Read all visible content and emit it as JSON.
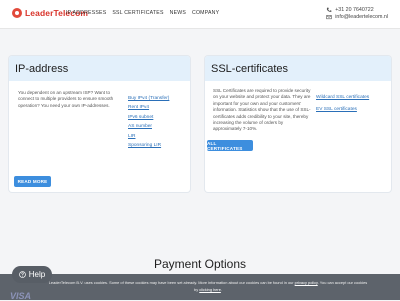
{
  "header": {
    "logo_text": "LeaderTelecom",
    "nav": [
      "IP ADDRESSES",
      "SSL CERTIFICATES",
      "NEWS",
      "COMPANY"
    ],
    "phone": "+31 20 7640722",
    "email": "info@leadertelecom.nl"
  },
  "ip_card": {
    "title": "IP-address",
    "description": "You dependent on an upstream ISP? Want to connect to multiple providers to ensure smooth operation? You need your own IP-addresses.",
    "links": [
      "Buy IPv4 (Transfer)",
      "Rent IPv4",
      "IPv6 subnet",
      "AS number",
      "LIR",
      "Sponsoring LIR"
    ],
    "button": "READ MORE"
  },
  "ssl_card": {
    "title": "SSL-certificates",
    "description": "SSL Certificates are required to provide security on your website and protect your data. They are important for your own and your customers' information. Statistics show that the use of SSL-certificates adds credibility to your site, thereby increasing the volume of orders by approximately 7-10%.",
    "links": [
      "Wildcard SSL certificates",
      "EV SSL certificates"
    ],
    "button": "ALL CERTIFICATES"
  },
  "payment": {
    "title": "Payment Options"
  },
  "cookie": {
    "text_1": "LeaderTelecom B.V. uses cookies. Some of these cookies may have been set already. More information about our cookies can be found in our ",
    "privacy_link": "privacy policy",
    "text_2": ". You can accept our cookies by ",
    "accept_link": "clicking here",
    "text_3": "."
  },
  "help": {
    "label": "Help"
  },
  "payment_logo": "VISA",
  "colors": {
    "brand": "#d8332a",
    "accent": "#3d8ede",
    "card_header_bg": "#e3f0fb",
    "cookie_bg": "#5d636b"
  }
}
